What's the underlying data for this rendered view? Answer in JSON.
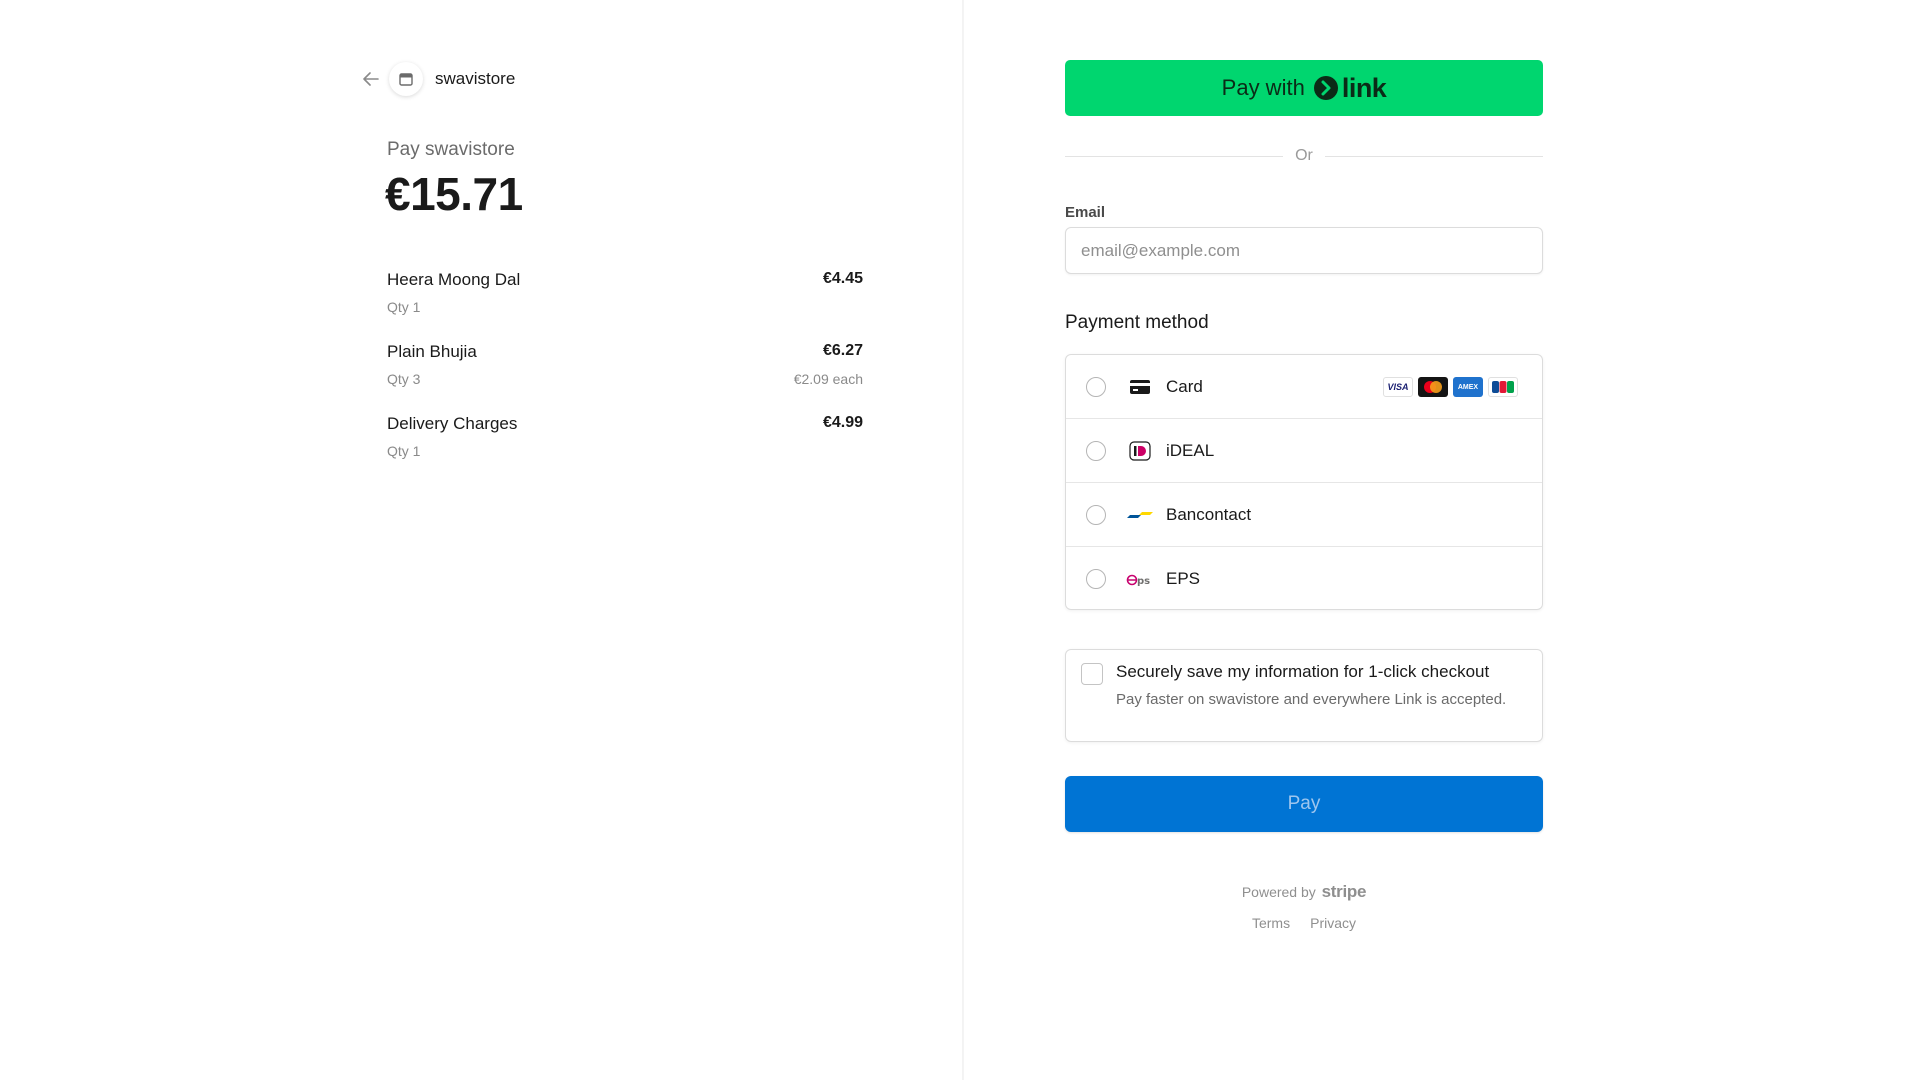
{
  "merchant": {
    "name": "swavistore",
    "pay_label": "Pay swavistore",
    "total": "€15.71"
  },
  "line_items": [
    {
      "name": "Heera Moong Dal",
      "qty": "Qty 1",
      "price": "€4.45",
      "each": ""
    },
    {
      "name": "Plain Bhujia",
      "qty": "Qty 3",
      "price": "€6.27",
      "each": "€2.09 each"
    },
    {
      "name": "Delivery Charges",
      "qty": "Qty 1",
      "price": "€4.99",
      "each": ""
    }
  ],
  "link_button": {
    "prefix": "Pay with",
    "brand": "link"
  },
  "divider": {
    "or": "Or"
  },
  "email": {
    "label": "Email",
    "placeholder": "email@example.com",
    "value": ""
  },
  "payment": {
    "label": "Payment method",
    "methods": [
      {
        "name": "Card",
        "icon": "card-icon"
      },
      {
        "name": "iDEAL",
        "icon": "ideal-icon"
      },
      {
        "name": "Bancontact",
        "icon": "bancontact-icon"
      },
      {
        "name": "EPS",
        "icon": "eps-icon"
      }
    ],
    "card_brands": [
      "visa-icon",
      "mastercard-icon",
      "amex-icon",
      "jcb-icon"
    ]
  },
  "save_info": {
    "title": "Securely save my information for 1-click checkout",
    "description": "Pay faster on swavistore and everywhere Link is accepted."
  },
  "pay_button": {
    "label": "Pay"
  },
  "footer": {
    "powered_by": "Powered by",
    "brand": "stripe",
    "terms": "Terms",
    "privacy": "Privacy"
  },
  "colors": {
    "link_green": "#00d66f",
    "pay_blue": "#0074d4"
  }
}
